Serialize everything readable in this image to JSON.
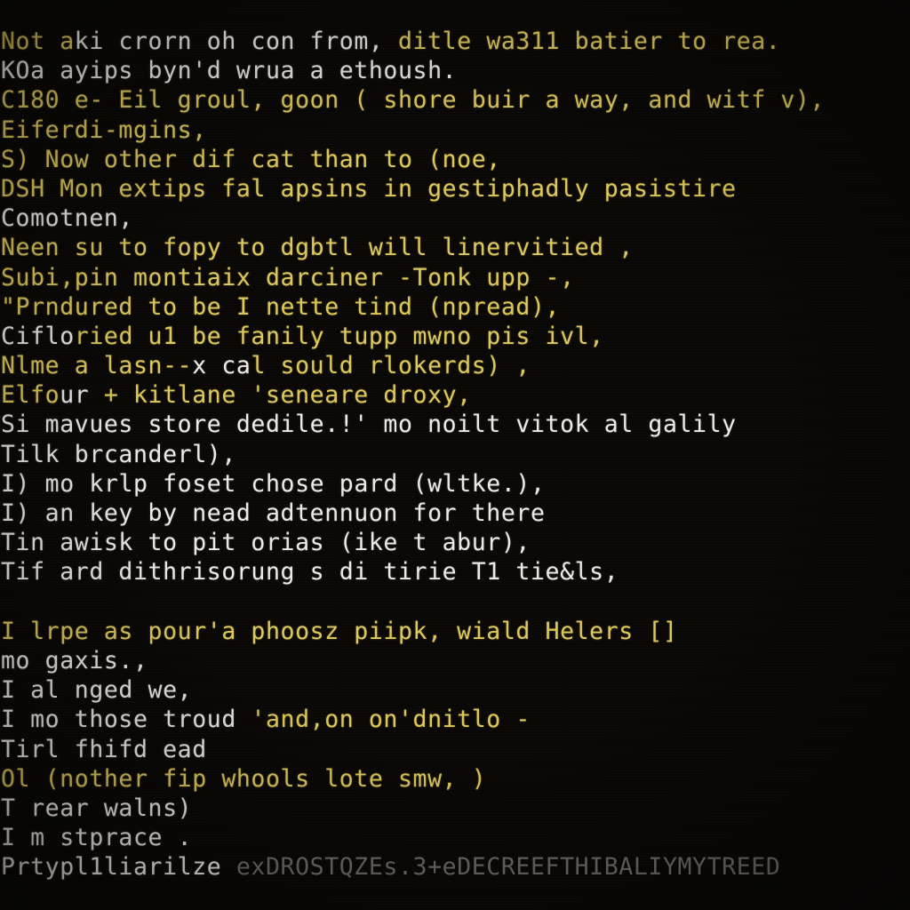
{
  "terminal": {
    "title": "terminal-output",
    "background_color": "#0a0806",
    "amber_color": "#ddc85e",
    "white_color": "#eceae6",
    "dim_color": "#6f6d6b",
    "lines": [
      {
        "id": "line-1",
        "segments": [
          {
            "text": "Not a",
            "color": "amber"
          },
          {
            "text": "ki cror",
            "color": "white"
          },
          {
            "text": "n oh con from, ",
            "color": "white"
          },
          {
            "text": "ditle wa311 batier to rea.",
            "color": "amber"
          }
        ]
      },
      {
        "id": "line-2",
        "segments": [
          {
            "text": "KOa ayips byn'd ",
            "color": "white"
          },
          {
            "text": "wrua a et",
            "color": "white"
          },
          {
            "text": "housh.",
            "color": "white"
          }
        ]
      },
      {
        "id": "line-3",
        "segments": [
          {
            "text": "C180 e- Eil groul, goon ( shore buir a way, and witf v),",
            "color": "amber"
          }
        ]
      },
      {
        "id": "line-4",
        "segments": [
          {
            "text": "Eiferdi-mgins,",
            "color": "amber"
          }
        ]
      },
      {
        "id": "line-5",
        "segments": [
          {
            "text": "S) Now other dif cat than to (noe,",
            "color": "amber"
          }
        ]
      },
      {
        "id": "line-6",
        "segments": [
          {
            "text": "DSH Mon extips fal apsins in gestiphadly pasistire",
            "color": "amber"
          }
        ]
      },
      {
        "id": "line-7",
        "segments": [
          {
            "text": "Comotnen,",
            "color": "white"
          }
        ]
      },
      {
        "id": "line-8",
        "segments": [
          {
            "text": "Neen su to fopy to dgbtl will linervitied ,",
            "color": "amber"
          }
        ]
      },
      {
        "id": "line-9",
        "segments": [
          {
            "text": "Subi,pin montiaix darciner -Tonk upp -,",
            "color": "amber"
          }
        ]
      },
      {
        "id": "line-10",
        "segments": [
          {
            "text": "\"Prndured to be I nette tind (npread),",
            "color": "amber"
          }
        ]
      },
      {
        "id": "line-11",
        "segments": [
          {
            "text": "Ciflo",
            "color": "white"
          },
          {
            "text": "ried u1 be fanily tupp mwno pis ivl,",
            "color": "amber"
          }
        ]
      },
      {
        "id": "line-12",
        "segments": [
          {
            "text": "Nlme a lasn--",
            "color": "amber"
          },
          {
            "text": "x ca",
            "color": "white"
          },
          {
            "text": "l sould rlokerds) ,",
            "color": "amber"
          }
        ]
      },
      {
        "id": "line-13",
        "segments": [
          {
            "text": "Elfo",
            "color": "amber"
          },
          {
            "text": "ur",
            "color": "white"
          },
          {
            "text": " + kitlane 'seneare droxy,",
            "color": "amber"
          }
        ]
      },
      {
        "id": "line-14",
        "segments": [
          {
            "text": "Si mavues store dedile.!' mo noilt vitok al galily",
            "color": "white"
          }
        ]
      },
      {
        "id": "line-15",
        "segments": [
          {
            "text": "Tilk brcanderl),",
            "color": "white"
          }
        ]
      },
      {
        "id": "line-16",
        "segments": [
          {
            "text": "I) ",
            "color": "white"
          },
          {
            "text": "mo",
            "color": "white"
          },
          {
            "text": " krlp foset chose pard (wltke.),",
            "color": "white"
          }
        ]
      },
      {
        "id": "line-17",
        "segments": [
          {
            "text": "I) an key by nead adtennuon for there",
            "color": "white"
          }
        ]
      },
      {
        "id": "line-18",
        "segments": [
          {
            "text": "Tin awisk to pit orias (ike t abur),",
            "color": "white"
          }
        ]
      },
      {
        "id": "line-19",
        "segments": [
          {
            "text": "Tif ard dithrisorung s di tirie T1 tie&ls,",
            "color": "white"
          }
        ]
      },
      {
        "id": "line-20",
        "segments": [
          {
            "text": "",
            "color": "blank"
          }
        ]
      },
      {
        "id": "line-21",
        "segments": [
          {
            "text": "I lrpe as pour'a phoosz piipk, wiald Helers []",
            "color": "amber"
          }
        ]
      },
      {
        "id": "line-22",
        "segments": [
          {
            "text": "mo gaxis.,",
            "color": "white"
          }
        ]
      },
      {
        "id": "line-23",
        "segments": [
          {
            "text": "I al nged we,",
            "color": "white"
          }
        ]
      },
      {
        "id": "line-24",
        "segments": [
          {
            "text": "I mo those troud ",
            "color": "white"
          },
          {
            "text": "'and,on on'dnitlo -",
            "color": "amber"
          }
        ]
      },
      {
        "id": "line-25",
        "segments": [
          {
            "text": "Tirl fhifd ead",
            "color": "white"
          }
        ]
      },
      {
        "id": "line-26",
        "segments": [
          {
            "text": "Ol (nother fip whools lote smw, )",
            "color": "amber"
          }
        ]
      },
      {
        "id": "line-27",
        "segments": [
          {
            "text": "T rear walns)",
            "color": "white"
          }
        ]
      },
      {
        "id": "line-28",
        "segments": [
          {
            "text": "I m stprace .",
            "color": "white"
          }
        ]
      },
      {
        "id": "line-29",
        "segments": [
          {
            "text": "Prtypl1liarilze ",
            "color": "white"
          },
          {
            "text": "exDROSTQZEs.3+eDECREEFTHIBALIYMYTREED",
            "color": "dim"
          }
        ]
      }
    ]
  }
}
